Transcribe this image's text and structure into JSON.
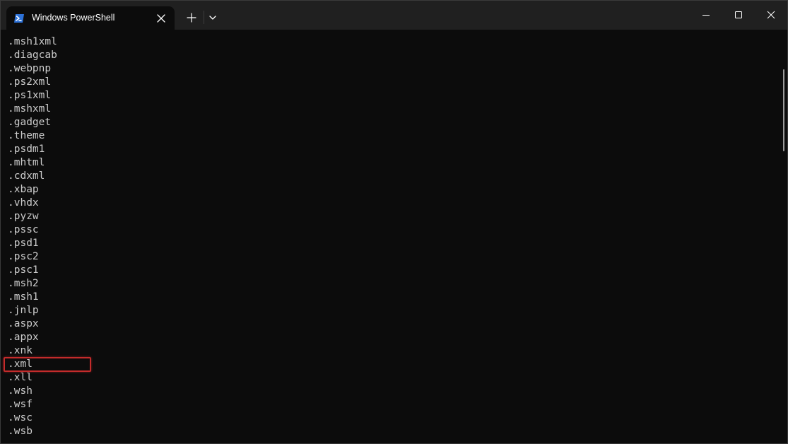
{
  "window": {
    "tab_title": "Windows PowerShell"
  },
  "icons": {
    "tab_icon": "powershell-icon",
    "tab_close": "close-icon",
    "new_tab": "plus-icon",
    "dropdown": "chevron-down-icon",
    "minimize": "minimize-icon",
    "maximize": "maximize-icon",
    "close": "close-icon"
  },
  "colors": {
    "background": "#0c0c0c",
    "titlebar": "#202020",
    "text": "#cccccc",
    "highlight": "#c42b2b"
  },
  "terminal": {
    "lines": [
      ".msh1xml",
      ".diagcab",
      ".webpnp",
      ".ps2xml",
      ".ps1xml",
      ".mshxml",
      ".gadget",
      ".theme",
      ".psdm1",
      ".mhtml",
      ".cdxml",
      ".xbap",
      ".vhdx",
      ".pyzw",
      ".pssc",
      ".psd1",
      ".psc2",
      ".psc1",
      ".msh2",
      ".msh1",
      ".jnlp",
      ".aspx",
      ".appx",
      ".xnk",
      ".xml",
      ".xll",
      ".wsh",
      ".wsf",
      ".wsc",
      ".wsb"
    ],
    "highlighted_line": ".xml"
  }
}
